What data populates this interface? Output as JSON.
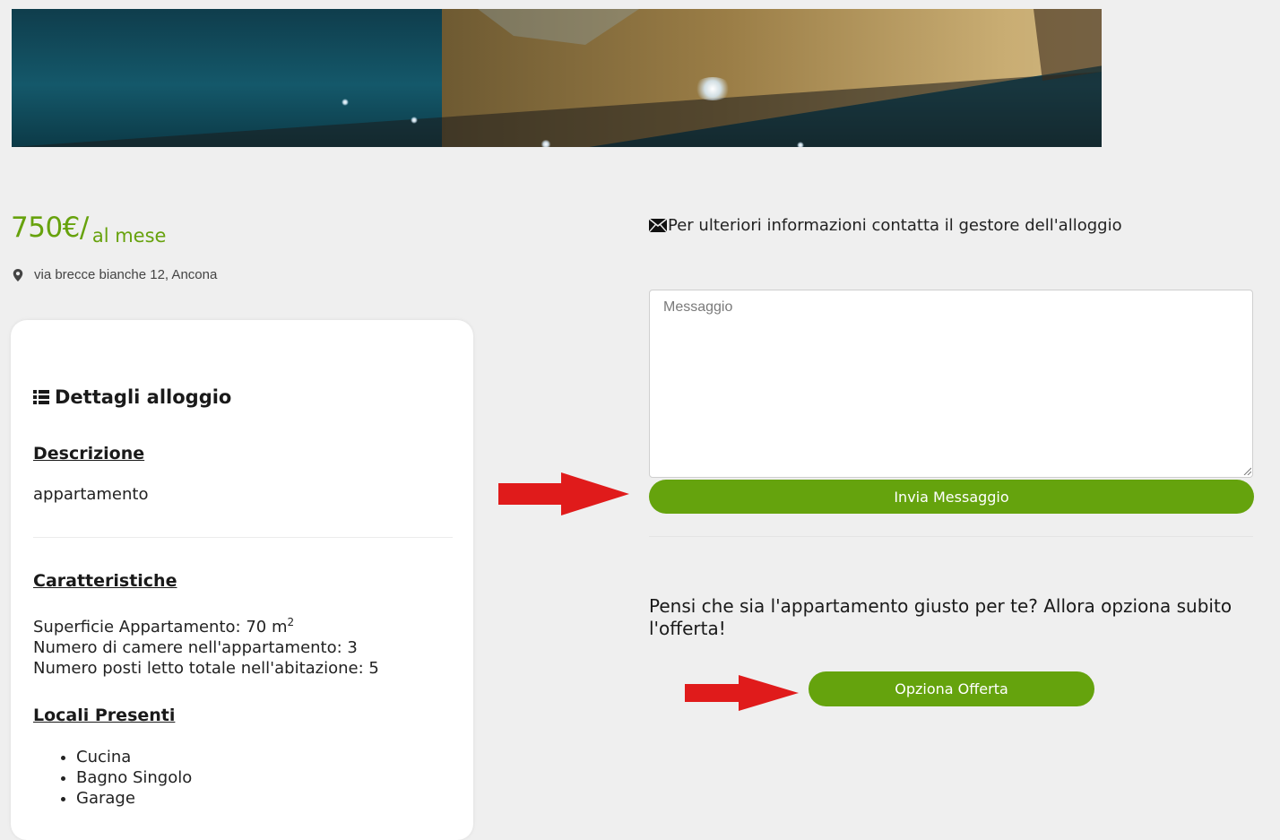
{
  "price": {
    "amount": "750€/",
    "unit": "al mese"
  },
  "address": "via brecce bianche 12, Ancona",
  "details": {
    "title": "Dettagli alloggio",
    "description_label": "Descrizione",
    "description_value": "appartamento",
    "features_label": "Caratteristiche",
    "surface_text": "Superficie Appartamento: 70 m",
    "surface_sup": "2",
    "rooms_text": "Numero di camere nell'appartamento: 3",
    "beds_text": "Numero posti letto totale nell'abitazione: 5",
    "premises_label": "Locali Presenti",
    "premises": [
      "Cucina",
      "Bagno Singolo",
      "Garage"
    ]
  },
  "contact": {
    "text": "Per ulteriori informazioni contatta il gestore dell'alloggio",
    "message_placeholder": "Messaggio",
    "send_label": "Invia Messaggio"
  },
  "offer": {
    "question": "Pensi che sia l'appartamento giusto per te? Allora opziona subito l'offerta!",
    "button_label": "Opziona Offerta"
  },
  "colors": {
    "accent_green": "#65a30d",
    "price_green": "#67a20d",
    "annotation_arrow": "#e01b1b"
  },
  "icons": {
    "address": "map-pin-icon",
    "details": "list-icon",
    "contact": "envelope-icon",
    "annotation": "arrow-right-icon"
  }
}
